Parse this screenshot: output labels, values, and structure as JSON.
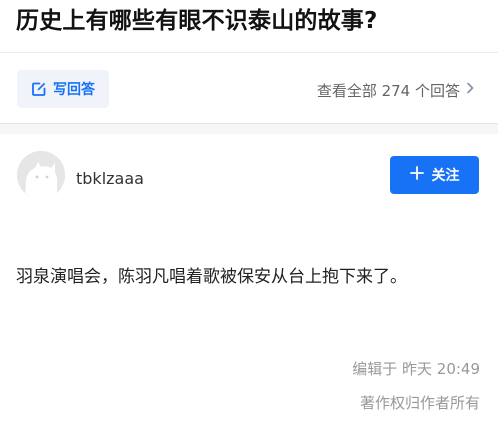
{
  "question": {
    "title": "历史上有哪些有眼不识泰山的故事?"
  },
  "actions": {
    "write_answer_label": "写回答",
    "write_answer_icon": "edit-icon",
    "view_all_label": "查看全部 274 个回答",
    "view_all_icon": "chevron-right-icon"
  },
  "author": {
    "name": "tbklzaaa",
    "avatar_icon": "default-avatar-icon",
    "follow_label": "关注",
    "follow_icon": "plus-icon"
  },
  "answer": {
    "content": "羽泉演唱会，陈羽凡唱着歌被保安从台上抱下来了。",
    "edit_time": "编辑于 昨天 20:49",
    "copyright": "著作权归作者所有"
  },
  "colors": {
    "brand_blue": "#1772f6",
    "write_btn_bg": "#f0f4fa",
    "meta_gray": "#999999",
    "divider_band": "#f6f6f6"
  }
}
